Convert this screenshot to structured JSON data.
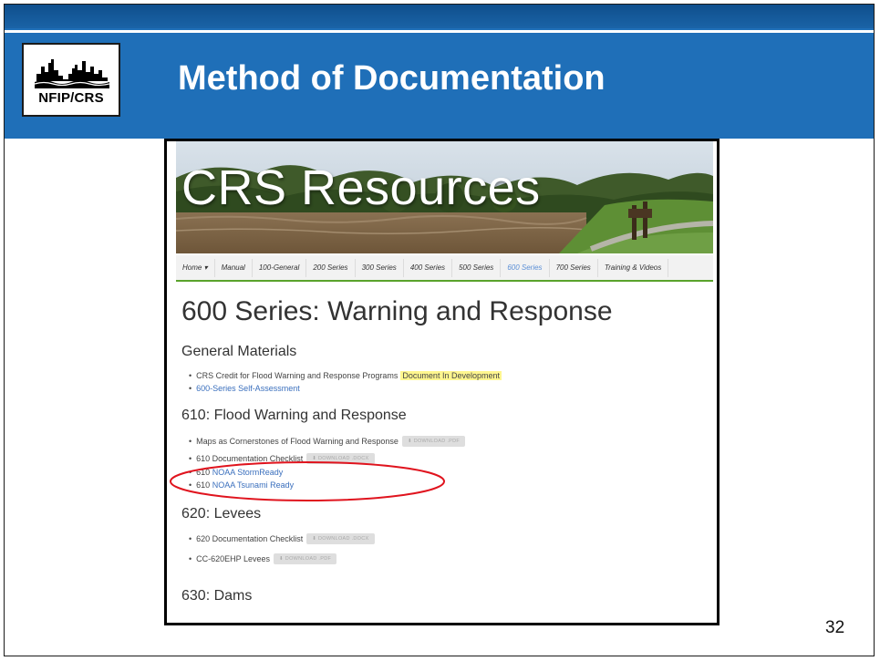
{
  "slide": {
    "title": "Method of Documentation",
    "page_number": "32",
    "logo": {
      "text": "NFIP/CRS",
      "icon": "city-skyline-icon"
    }
  },
  "website": {
    "banner_title": "CRS Resources",
    "nav": [
      {
        "label": "Home ▾",
        "active": false
      },
      {
        "label": "Manual",
        "active": false
      },
      {
        "label": "100-General",
        "active": false
      },
      {
        "label": "200 Series",
        "active": false
      },
      {
        "label": "300 Series",
        "active": false
      },
      {
        "label": "400 Series",
        "active": false
      },
      {
        "label": "500 Series",
        "active": false
      },
      {
        "label": "600 Series",
        "active": true
      },
      {
        "label": "700 Series",
        "active": false
      },
      {
        "label": "Training & Videos",
        "active": false
      }
    ],
    "page_heading": "600 Series: Warning and Response",
    "sections": {
      "general": {
        "heading": "General Materials",
        "item1": "CRS Credit for Flood Warning and Response Programs",
        "item1_badge": "Document In Development",
        "item2": "600-Series Self-Assessment"
      },
      "s610": {
        "heading": "610: Flood Warning and Response",
        "item1": "Maps as Cornerstones of Flood Warning and Response",
        "item1_button": "DOWNLOAD .PDF",
        "item2": "610 Documentation Checklist",
        "item2_button": "DOWNLOAD .DOCX",
        "item3_prefix": "610",
        "item3_link": "NOAA StormReady",
        "item4_prefix": "610",
        "item4_link": "NOAA Tsunami Ready"
      },
      "s620": {
        "heading": "620: Levees",
        "item1": "620 Documentation Checklist",
        "item1_button": "DOWNLOAD .DOCX",
        "item2": "CC-620EHP Levees",
        "item2_button": "DOWNLOAD .PDF"
      },
      "s630": {
        "heading": "630: Dams"
      }
    }
  },
  "colors": {
    "header_blue": "#1f6fb8",
    "nav_green": "#5aa32b",
    "link_blue": "#3a6fbd",
    "highlight_yellow": "#fff68f",
    "annotation_red": "#e0141e"
  }
}
